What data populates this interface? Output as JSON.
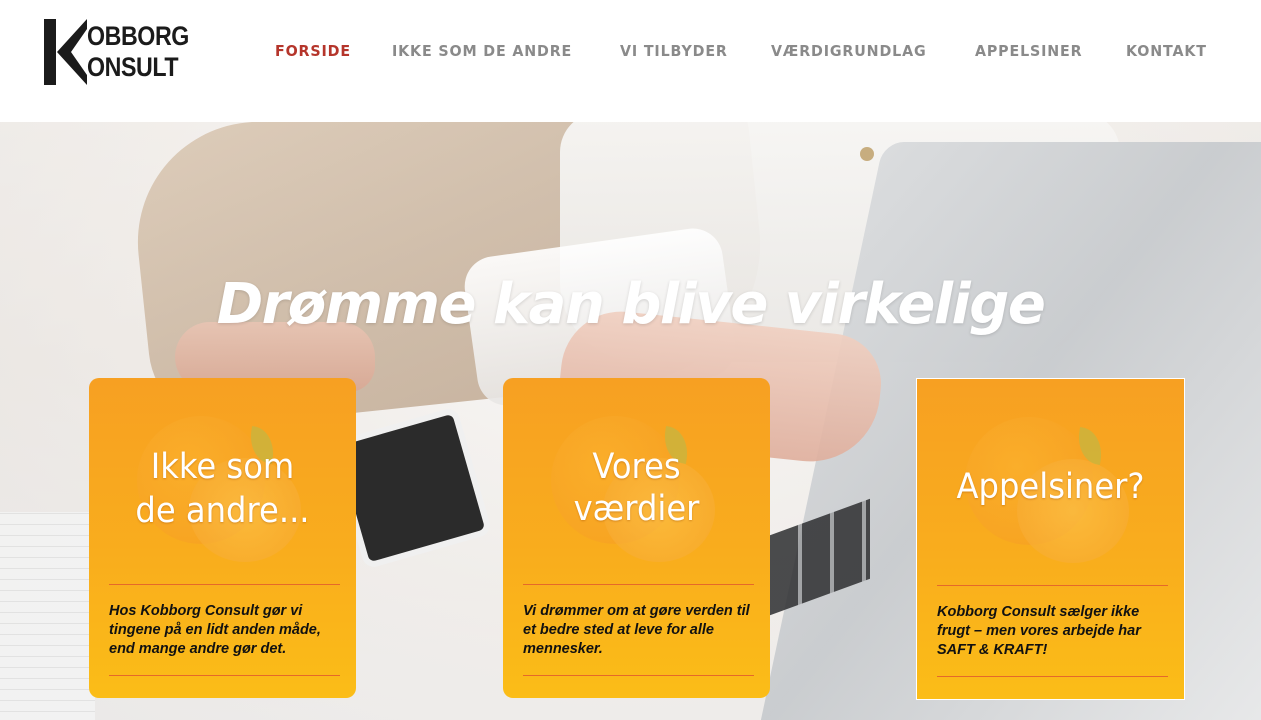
{
  "logo": {
    "line1": "OBBORG",
    "line2": "ONSULT",
    "alt": "Kobborg Consult"
  },
  "nav": {
    "items": [
      {
        "label": "FORSIDE",
        "active": true
      },
      {
        "label": "IKKE SOM DE ANDRE",
        "active": false
      },
      {
        "label": "VI TILBYDER",
        "active": false
      },
      {
        "label": "VÆRDIGRUNDLAG",
        "active": false
      },
      {
        "label": "APPELSINER",
        "active": false
      },
      {
        "label": "KONTAKT",
        "active": false
      }
    ]
  },
  "hero": {
    "title": "Drømme kan blive virkelige"
  },
  "cards": [
    {
      "heading_lines": [
        "Ikke som",
        "de andre..."
      ],
      "text": "Hos Kobborg Consult gør vi tingene på en lidt anden måde, end mange andre gør det."
    },
    {
      "heading_lines": [
        "Vores",
        "værdier"
      ],
      "text": "Vi drømmer om at gøre verden til et bedre sted at leve for alle mennesker."
    },
    {
      "heading_lines": [
        "Appelsiner?"
      ],
      "text": "Kobborg Consult sælger ikke frugt – men vores arbejde har SAFT & KRAFT!"
    }
  ],
  "colors": {
    "accent": "#b5352b",
    "nav": "#8a8a8a",
    "card": "#f9ad1d",
    "rule": "#e5692a"
  }
}
